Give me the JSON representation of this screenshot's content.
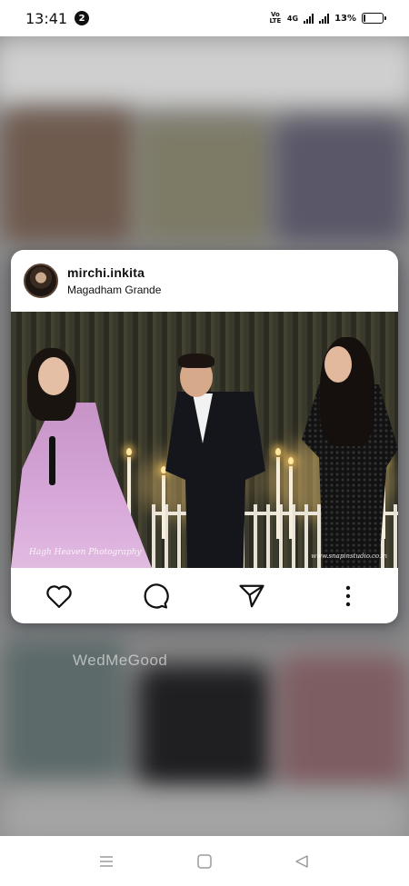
{
  "status_bar": {
    "time": "13:41",
    "notification_count": "2",
    "volte_label": "Vo LTE",
    "network_type": "4G",
    "battery_percent": "13%",
    "battery_level": 0.13
  },
  "backdrop": {
    "watermark": "WedMeGood"
  },
  "post": {
    "username": "mirchi.inkita",
    "location": "Magadham Grande",
    "photo_credit_left": "Hagh Heaven Photography",
    "photo_credit_right": "www.snapinstudio.co.in",
    "actions": {
      "like_icon": "heart-icon",
      "comment_icon": "comment-icon",
      "share_icon": "send-icon",
      "more_icon": "more-vertical-icon"
    }
  },
  "nav_bar": {
    "recents_icon": "menu-icon",
    "home_icon": "square-icon",
    "back_icon": "triangle-back-icon"
  },
  "colors": {
    "card_background": "#ffffff",
    "text_primary": "#111111",
    "gown": "#d7a8d9"
  }
}
